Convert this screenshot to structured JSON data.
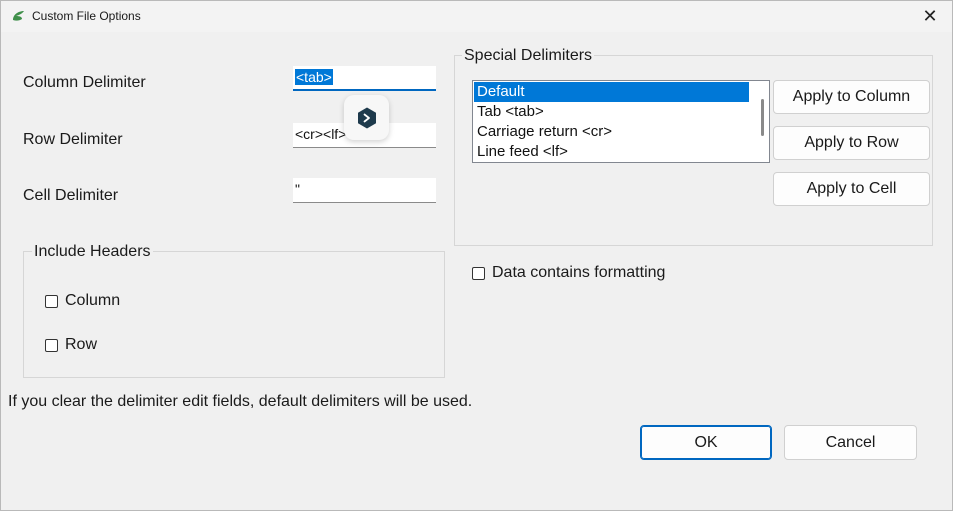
{
  "window": {
    "title": "Custom File Options",
    "close_glyph": "✕",
    "app_icon": "app-logo-icon"
  },
  "delimiters": {
    "column_label": "Column Delimiter",
    "column_value": "<tab>",
    "row_label": "Row Delimiter",
    "row_value": "<cr><lf>",
    "cell_label": "Cell Delimiter",
    "cell_value": "\""
  },
  "include_headers": {
    "legend": "Include Headers",
    "column_label": "Column",
    "column_checked": false,
    "row_label": "Row",
    "row_checked": false
  },
  "special_delimiters": {
    "legend": "Special Delimiters",
    "items": [
      {
        "label": "Default",
        "selected": true
      },
      {
        "label": "Tab <tab>",
        "selected": false
      },
      {
        "label": "Carriage return <cr>",
        "selected": false
      },
      {
        "label": "Line feed <lf>",
        "selected": false
      }
    ],
    "apply_column": "Apply to Column",
    "apply_row": "Apply to Row",
    "apply_cell": "Apply to Cell"
  },
  "formatting": {
    "label": "Data contains formatting",
    "checked": false
  },
  "hint": "If you clear the delimiter edit fields, default delimiters will be used.",
  "buttons": {
    "ok": "OK",
    "cancel": "Cancel"
  },
  "overlay": {
    "icon": "overlay-badge-icon"
  },
  "colors": {
    "accent": "#0078d7",
    "focus_border": "#0067c0",
    "background": "#f0f0f0"
  }
}
